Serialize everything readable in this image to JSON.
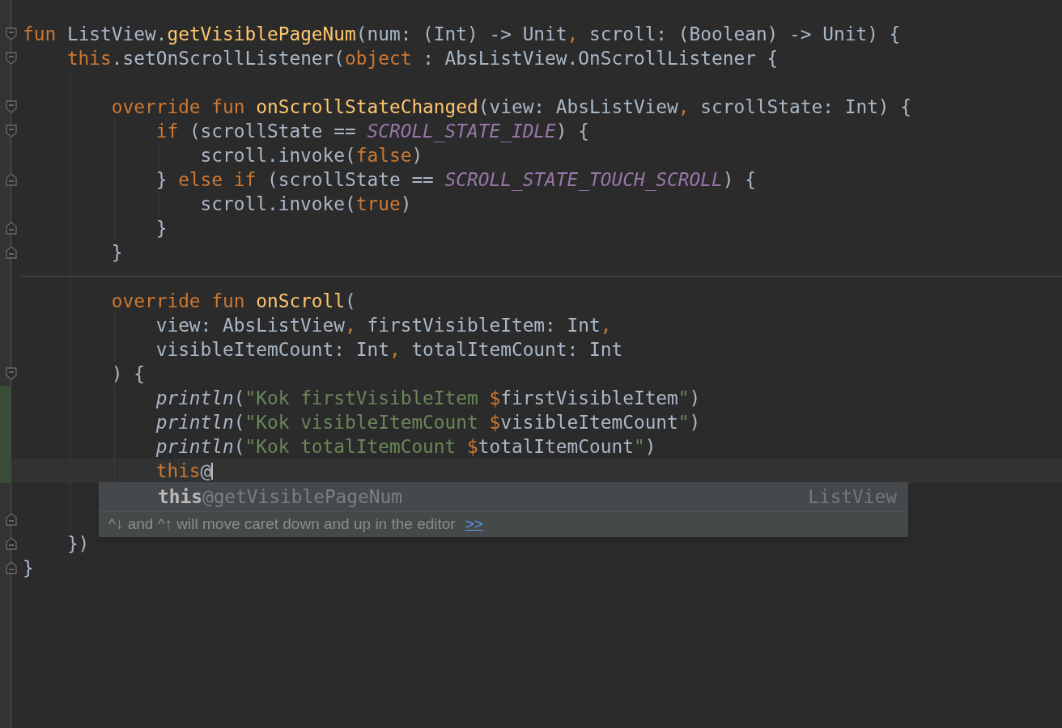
{
  "editor": {
    "lines": [
      {
        "kind": "code",
        "fold_start": true,
        "tokens": [
          {
            "text": "fun ",
            "kind": "keyword"
          },
          {
            "text": "ListView.",
            "kind": "plain"
          },
          {
            "text": "getVisiblePageNum",
            "kind": "decl"
          },
          {
            "text": "(num: (Int) -> Unit",
            "kind": "plain"
          },
          {
            "text": ",",
            "kind": "keyword"
          },
          {
            "text": " scroll: (Boolean) -> Unit) {",
            "kind": "plain"
          }
        ]
      },
      {
        "kind": "code",
        "fold_start": true,
        "tokens": [
          {
            "text": "    this",
            "kind": "keyword"
          },
          {
            "text": ".setOnScrollListener(",
            "kind": "plain"
          },
          {
            "text": "object",
            "kind": "keyword"
          },
          {
            "text": " : AbsListView.OnScrollListener {",
            "kind": "plain"
          }
        ]
      },
      {
        "kind": "blank"
      },
      {
        "kind": "code",
        "fold_start": true,
        "tokens": [
          {
            "text": "        override fun ",
            "kind": "keyword"
          },
          {
            "text": "onScrollStateChanged",
            "kind": "decl"
          },
          {
            "text": "(view: AbsListView",
            "kind": "plain"
          },
          {
            "text": ",",
            "kind": "keyword"
          },
          {
            "text": " scrollState: Int) {",
            "kind": "plain"
          }
        ]
      },
      {
        "kind": "code",
        "fold_start": true,
        "tokens": [
          {
            "text": "            if ",
            "kind": "keyword"
          },
          {
            "text": "(scrollState == ",
            "kind": "plain"
          },
          {
            "text": "SCROLL_STATE_IDLE",
            "kind": "constant"
          },
          {
            "text": ") {",
            "kind": "plain"
          }
        ]
      },
      {
        "kind": "code",
        "tokens": [
          {
            "text": "                scroll.invoke(",
            "kind": "plain"
          },
          {
            "text": "false",
            "kind": "keyword"
          },
          {
            "text": ")",
            "kind": "plain"
          }
        ]
      },
      {
        "kind": "code",
        "fold_end": true,
        "tokens": [
          {
            "text": "            } ",
            "kind": "plain"
          },
          {
            "text": "else if ",
            "kind": "keyword"
          },
          {
            "text": "(scrollState == ",
            "kind": "plain"
          },
          {
            "text": "SCROLL_STATE_TOUCH_SCROLL",
            "kind": "constant"
          },
          {
            "text": ") {",
            "kind": "plain"
          }
        ]
      },
      {
        "kind": "code",
        "tokens": [
          {
            "text": "                scroll.invoke(",
            "kind": "plain"
          },
          {
            "text": "true",
            "kind": "keyword"
          },
          {
            "text": ")",
            "kind": "plain"
          }
        ]
      },
      {
        "kind": "code",
        "fold_end": true,
        "tokens": [
          {
            "text": "            }",
            "kind": "plain"
          }
        ]
      },
      {
        "kind": "code",
        "fold_end": true,
        "tokens": [
          {
            "text": "        }",
            "kind": "plain"
          }
        ]
      },
      {
        "kind": "blank"
      },
      {
        "kind": "code",
        "separator_above": true,
        "tokens": [
          {
            "text": "        override fun ",
            "kind": "keyword"
          },
          {
            "text": "onScroll",
            "kind": "decl"
          },
          {
            "text": "(",
            "kind": "plain"
          }
        ]
      },
      {
        "kind": "code",
        "tokens": [
          {
            "text": "            view: AbsListView",
            "kind": "plain"
          },
          {
            "text": ",",
            "kind": "keyword"
          },
          {
            "text": " firstVisibleItem: Int",
            "kind": "plain"
          },
          {
            "text": ",",
            "kind": "keyword"
          }
        ]
      },
      {
        "kind": "code",
        "tokens": [
          {
            "text": "            visibleItemCount: Int",
            "kind": "plain"
          },
          {
            "text": ",",
            "kind": "keyword"
          },
          {
            "text": " totalItemCount: Int",
            "kind": "plain"
          }
        ]
      },
      {
        "kind": "code",
        "fold_start": true,
        "tokens": [
          {
            "text": "        ) {",
            "kind": "plain"
          }
        ]
      },
      {
        "kind": "code",
        "changed": true,
        "tokens": [
          {
            "text": "            println",
            "kind": "call"
          },
          {
            "text": "(",
            "kind": "plain"
          },
          {
            "text": "\"Kok firstVisibleItem ",
            "kind": "string"
          },
          {
            "text": "$",
            "kind": "keyword"
          },
          {
            "text": "firstVisibleItem",
            "kind": "plain"
          },
          {
            "text": "\"",
            "kind": "string"
          },
          {
            "text": ")",
            "kind": "plain"
          }
        ]
      },
      {
        "kind": "code",
        "changed": true,
        "tokens": [
          {
            "text": "            println",
            "kind": "call"
          },
          {
            "text": "(",
            "kind": "plain"
          },
          {
            "text": "\"Kok visibleItemCount ",
            "kind": "string"
          },
          {
            "text": "$",
            "kind": "keyword"
          },
          {
            "text": "visibleItemCount",
            "kind": "plain"
          },
          {
            "text": "\"",
            "kind": "string"
          },
          {
            "text": ")",
            "kind": "plain"
          }
        ]
      },
      {
        "kind": "code",
        "changed": true,
        "tokens": [
          {
            "text": "            println",
            "kind": "call"
          },
          {
            "text": "(",
            "kind": "plain"
          },
          {
            "text": "\"Kok totalItemCount ",
            "kind": "string"
          },
          {
            "text": "$",
            "kind": "keyword"
          },
          {
            "text": "totalItemCount",
            "kind": "plain"
          },
          {
            "text": "\"",
            "kind": "string"
          },
          {
            "text": ")",
            "kind": "plain"
          }
        ]
      },
      {
        "kind": "code",
        "changed": true,
        "current": true,
        "tokens": [
          {
            "text": "            this",
            "kind": "keyword"
          },
          {
            "text": "@",
            "kind": "plain"
          }
        ]
      },
      {
        "kind": "blank"
      },
      {
        "kind": "blank",
        "fold_end": true
      },
      {
        "kind": "code",
        "fold_end": true,
        "tokens": [
          {
            "text": "    })",
            "kind": "plain"
          }
        ]
      },
      {
        "kind": "code",
        "fold_end": true,
        "tokens": [
          {
            "text": "}",
            "kind": "plain"
          }
        ]
      }
    ]
  },
  "completion_popup": {
    "items": [
      {
        "prefix": "this",
        "rest": "@getVisiblePageNum",
        "type": "ListView"
      }
    ],
    "hint": {
      "text": "^↓ and ^↑ will move caret down and up in the editor",
      "link": ">>"
    }
  }
}
